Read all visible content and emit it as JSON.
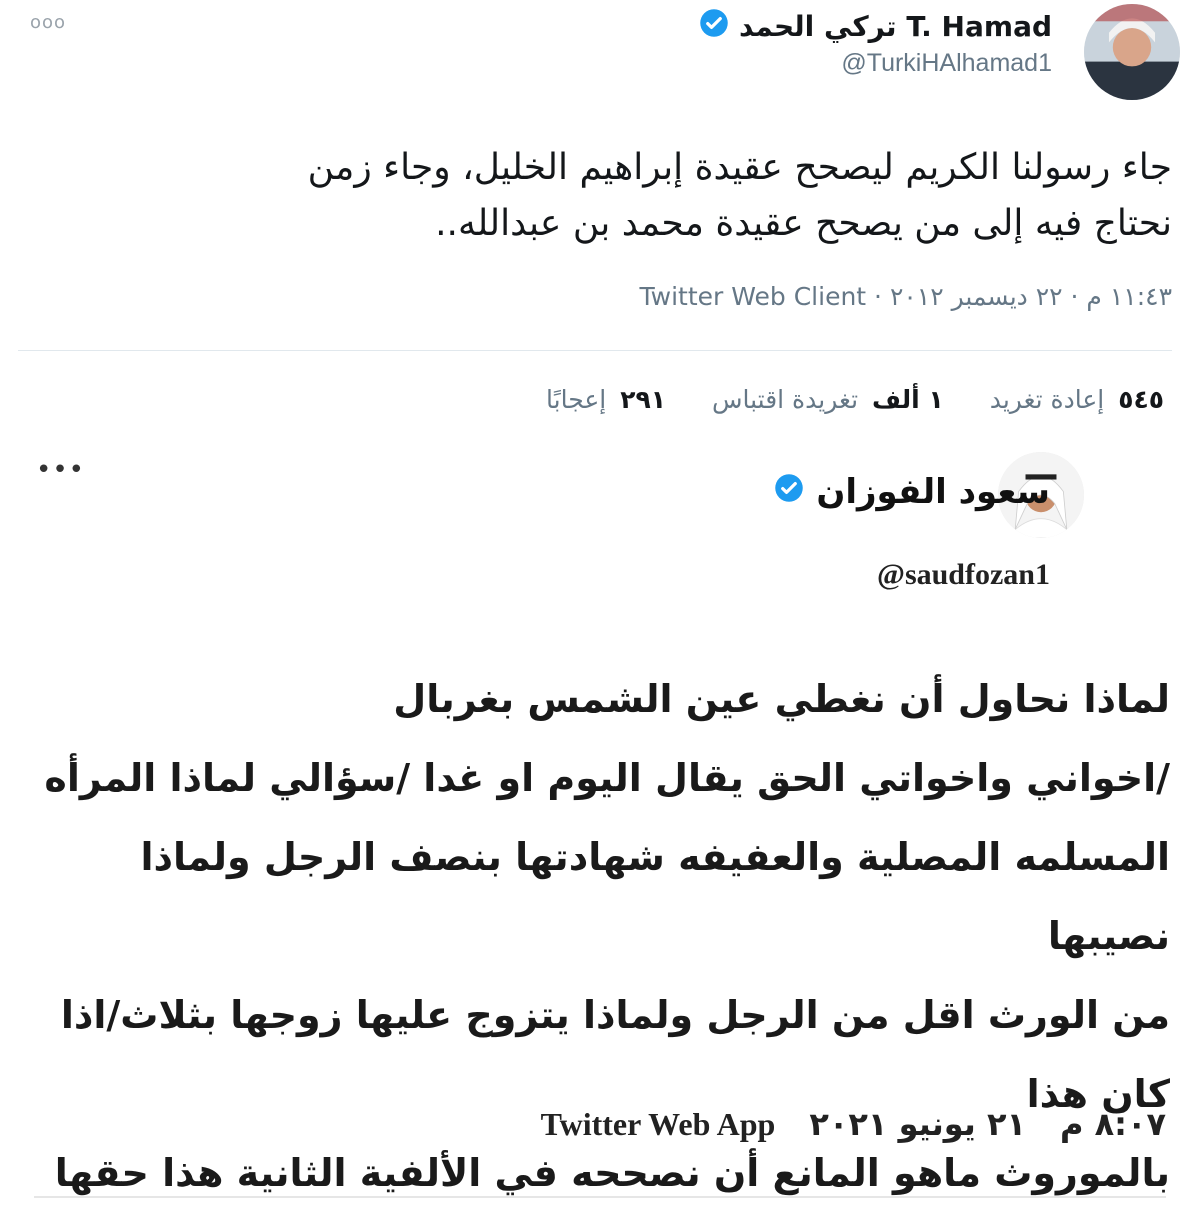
{
  "tweet1": {
    "author_name": "تركي الحمد T. Hamad",
    "handle": "@TurkiHAlhamad1",
    "verified": true,
    "text_lines": [
      "جاء رسولنا الكريم ليصحح عقيدة إبراهيم الخليل، وجاء زمن",
      "نحتاج فيه إلى من يصحح عقيدة محمد بن عبدالله.."
    ],
    "meta": "١١:٤٣ م · ٢٢ ديسمبر ٢٠١٢ · Twitter Web Client",
    "stats": {
      "retweets_value": "٥٤٥",
      "retweets_label": "إعادة تغريد",
      "quotes_value": "١ ألف",
      "quotes_label": "تغريدة اقتباس",
      "likes_value": "٢٩١",
      "likes_label": "إعجابًا"
    },
    "more_icon": "more-dots-icon"
  },
  "tweet2": {
    "author_name": "سعود الفوزان",
    "handle": "@saudfozan1",
    "verified": true,
    "text_lines": [
      "لماذا نحاول أن نغطي عين الشمس بغربال",
      "/اخواني واخواتي الحق يقال اليوم او غدا /سؤالي لماذا المرأه",
      "المسلمه المصلية والعفيفه شهادتها بنصف الرجل ولماذا نصيبها",
      "من الورث اقل من الرجل ولماذا يتزوج عليها زوجها بثلاث/اذا كان هذا",
      "بالموروث ماهو المانع أن نصححه في الألفية الثانية هذا حقها"
    ],
    "time": "٨:٠٧ م",
    "date": "٢١ يونيو ٢٠٢١",
    "client": "Twitter Web App",
    "more_icon": "more-dots-icon"
  },
  "colors": {
    "verified_blue": "#1d9bf0",
    "meta_gray": "#657786",
    "text_dark": "#14171a"
  }
}
